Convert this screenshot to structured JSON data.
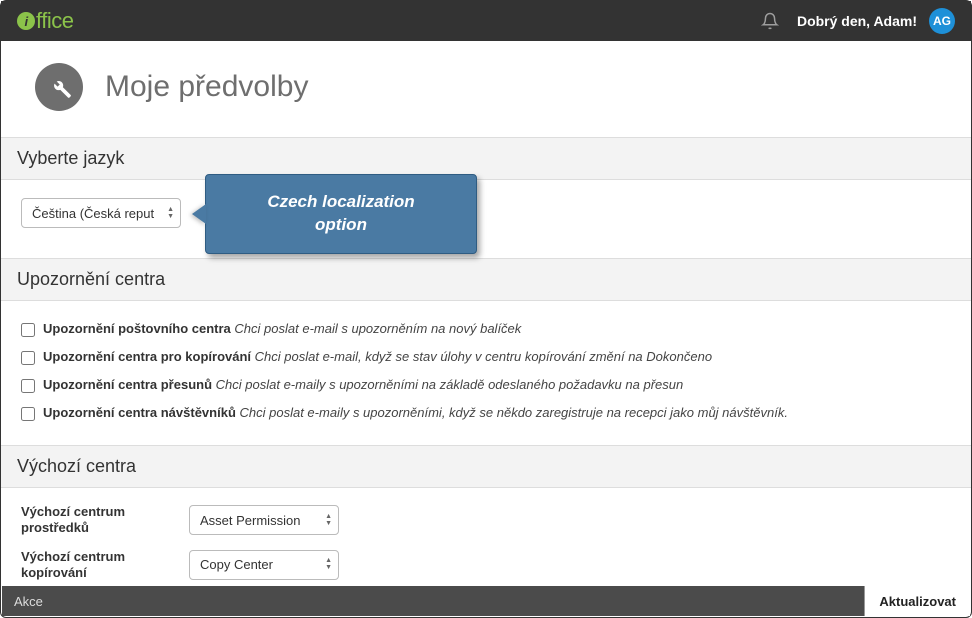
{
  "header": {
    "logo_rest": "ffice",
    "logo_i": "i",
    "greeting": "Dobrý den, Adam!",
    "avatar_initials": "AG"
  },
  "page": {
    "title": "Moje předvolby"
  },
  "language_section": {
    "heading": "Vyberte jazyk",
    "selected": "Čeština (Česká reput"
  },
  "callout": {
    "line1": "Czech localization",
    "line2": "option"
  },
  "alerts_section": {
    "heading": "Upozornění centra",
    "items": [
      {
        "label": "Upozornění poštovního centra",
        "desc": "Chci poslat e-mail s upozorněním na nový balíček"
      },
      {
        "label": "Upozornění centra pro kopírování",
        "desc": "Chci poslat e-mail, když se stav úlohy v centru kopírování změní na Dokončeno"
      },
      {
        "label": "Upozornění centra přesunů",
        "desc": "Chci poslat e-maily s upozorněními na základě odeslaného požadavku na přesun"
      },
      {
        "label": "Upozornění centra návštěvníků",
        "desc": "Chci poslat e-maily s upozorněními, když se někdo zaregistruje na recepci jako můj návštěvník."
      }
    ]
  },
  "defaults_section": {
    "heading": "Výchozí centra",
    "rows": [
      {
        "label": "Výchozí centrum prostředků",
        "value": "Asset Permission"
      },
      {
        "label": "Výchozí centrum kopírování",
        "value": "Copy Center"
      }
    ]
  },
  "footer": {
    "actions_label": "Akce",
    "update_label": "Aktualizovat"
  }
}
